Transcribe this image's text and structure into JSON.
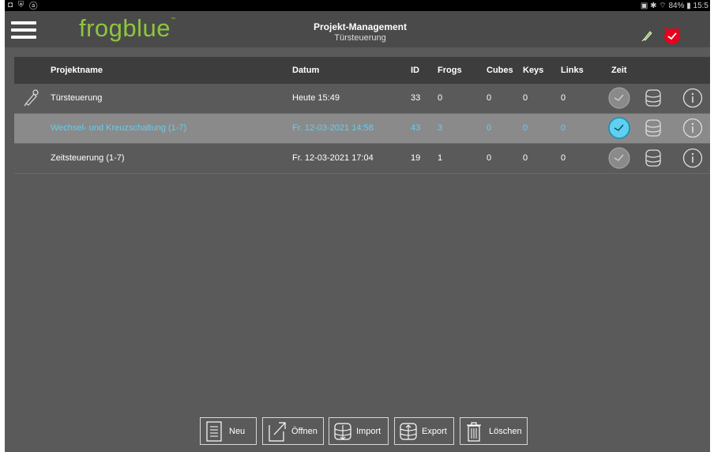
{
  "statusbar": {
    "left_icons": "◘ ⛨ ⓐ",
    "right_text": "▣ ✱ ⌔ 84% ▮ 15:5"
  },
  "appbar": {
    "logo": "frogblue",
    "logo_tm": "™",
    "title": "Projekt-Management",
    "subtitle": "Türsteuerung"
  },
  "table": {
    "headers": {
      "name": "Projektname",
      "date": "Datum",
      "id": "ID",
      "frogs": "Frogs",
      "cubes": "Cubes",
      "keys": "Keys",
      "links": "Links",
      "zeit": "Zeit"
    },
    "rows": [
      {
        "name": "Türsteuerung",
        "date": "Heute 15:49",
        "id": "33",
        "frogs": "0",
        "cubes": "0",
        "keys": "0",
        "links": "0"
      },
      {
        "name": "Wechsel- und Kreuzschaltung (1-7)",
        "date": "Fr. 12-03-2021 14:58",
        "id": "43",
        "frogs": "3",
        "cubes": "0",
        "keys": "0",
        "links": "0"
      },
      {
        "name": "Zeitsteuerung (1-7)",
        "date": "Fr. 12-03-2021 17:04",
        "id": "19",
        "frogs": "1",
        "cubes": "0",
        "keys": "0",
        "links": "0"
      }
    ]
  },
  "toolbar": {
    "new": "Neu",
    "open": "Öffnen",
    "import": "Import",
    "export": "Export",
    "delete": "Löschen"
  },
  "colors": {
    "accent_green": "#8dc63f",
    "selected_text": "#5fd0f0",
    "alarm_red": "#e8001c"
  },
  "icons": [
    "menu-icon",
    "pen-icon",
    "alarm-clock-icon",
    "clock-icon",
    "database-icon",
    "info-icon",
    "document-icon",
    "open-external-icon",
    "import-icon",
    "export-icon",
    "trash-icon"
  ]
}
